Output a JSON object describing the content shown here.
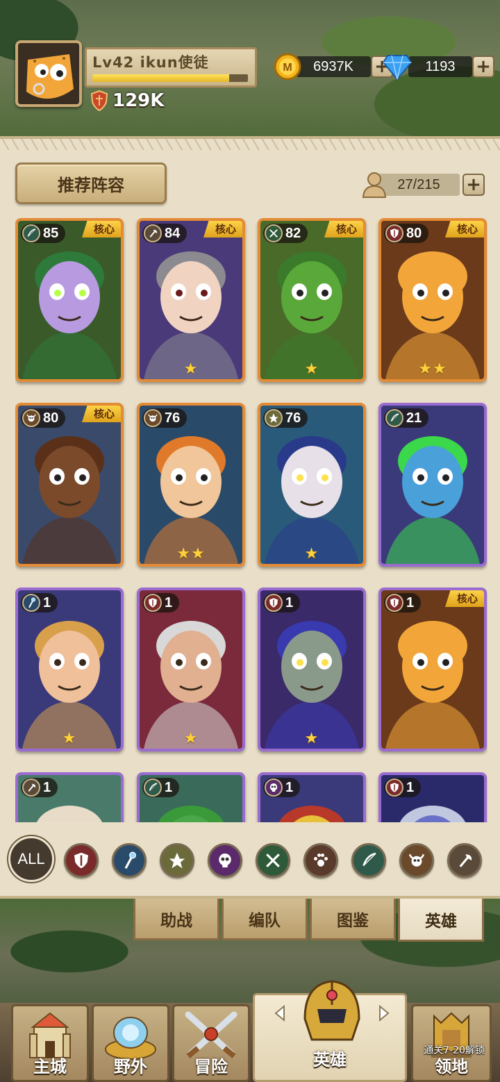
{
  "player": {
    "level_label": "Lv42",
    "name": "ikun使徒",
    "xp_fraction": 0.88,
    "power": "129K"
  },
  "currencies": {
    "gold": "6937K",
    "diamond": "1193",
    "plus_label": "+"
  },
  "recommend_button": "推荐阵容",
  "hero_count": "27/215",
  "core_label": "核心",
  "heroes": [
    {
      "level": "85",
      "class_icon": "bow-icon",
      "core": true,
      "stars": "",
      "frame": "orange"
    },
    {
      "level": "84",
      "class_icon": "axe-icon",
      "core": true,
      "stars": "★",
      "frame": "orange"
    },
    {
      "level": "82",
      "class_icon": "crossed-swords-icon",
      "core": true,
      "stars": "★",
      "frame": "orange"
    },
    {
      "level": "80",
      "class_icon": "shield-icon",
      "core": true,
      "stars": "★★",
      "frame": "orange"
    },
    {
      "level": "80",
      "class_icon": "skull-horns-icon",
      "core": true,
      "stars": "",
      "frame": "orange"
    },
    {
      "level": "76",
      "class_icon": "skull-horns-icon",
      "core": false,
      "stars": "★★",
      "frame": "orange"
    },
    {
      "level": "76",
      "class_icon": "emblem-icon",
      "core": false,
      "stars": "★",
      "frame": "orange"
    },
    {
      "level": "21",
      "class_icon": "bow-icon",
      "core": false,
      "stars": "",
      "frame": "purple"
    },
    {
      "level": "1",
      "class_icon": "staff-icon",
      "core": false,
      "stars": "★",
      "frame": "purple"
    },
    {
      "level": "1",
      "class_icon": "shield-icon",
      "core": false,
      "stars": "★",
      "frame": "purple"
    },
    {
      "level": "1",
      "class_icon": "shield-icon",
      "core": false,
      "stars": "★",
      "frame": "purple"
    },
    {
      "level": "1",
      "class_icon": "shield-icon",
      "core": true,
      "stars": "",
      "frame": "purple"
    },
    {
      "level": "1",
      "class_icon": "axe-icon",
      "core": false,
      "stars": "",
      "frame": "purple"
    },
    {
      "level": "1",
      "class_icon": "bow-icon",
      "core": false,
      "stars": "",
      "frame": "purple"
    },
    {
      "level": "1",
      "class_icon": "skull-icon",
      "core": false,
      "stars": "",
      "frame": "purple"
    },
    {
      "level": "1",
      "class_icon": "shield-icon",
      "core": false,
      "stars": "",
      "frame": "purple"
    }
  ],
  "filters": {
    "all_label": "ALL",
    "icons": [
      "shield-icon",
      "staff-icon",
      "emblem-icon",
      "skull-icon",
      "crossed-swords-icon",
      "paw-icon",
      "bow-icon",
      "skull-horns-icon",
      "axe-icon"
    ]
  },
  "sub_tabs": [
    "助战",
    "编队",
    "图鉴",
    "英雄"
  ],
  "active_sub_tab": "英雄",
  "nav": {
    "items": [
      "主城",
      "野外",
      "冒险",
      "英雄",
      "领地"
    ],
    "active": "英雄",
    "locked_note": "通关7-20解锁"
  },
  "colors": {
    "orange_frame": "#e38b35",
    "purple_frame": "#9a6bd0",
    "panel_bg": "#e9dfc8",
    "core_tag": "#ffd64a"
  }
}
